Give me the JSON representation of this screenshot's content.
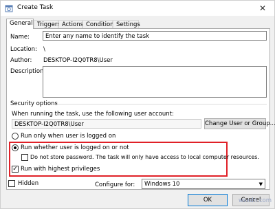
{
  "window": {
    "title": "Create Task",
    "close_glyph": "✕"
  },
  "tabs": [
    {
      "label": "General"
    },
    {
      "label": "Triggers"
    },
    {
      "label": "Actions"
    },
    {
      "label": "Conditions"
    },
    {
      "label": "Settings"
    }
  ],
  "general": {
    "name_label": "Name:",
    "name_value": "Enter any name to identify the task",
    "location_label": "Location:",
    "location_value": "\\",
    "author_label": "Author:",
    "author_value": "DESKTOP-I2Q0TR8\\User",
    "description_label": "Description:"
  },
  "security": {
    "group_label": "Security options",
    "account_prompt": "When running the task, use the following user account:",
    "account_value": "DESKTOP-I2Q0TR8\\User",
    "change_button": "Change User or Group...",
    "radio_logged_on": "Run only when user is logged on",
    "radio_whether": "Run whether user is logged on or not",
    "radio_selected": "whether",
    "check_no_password": "Do not store password.  The task will only have access to local computer resources.",
    "check_highest": "Run with highest privileges",
    "check_highest_checked": true
  },
  "bottom": {
    "hidden_label": "Hidden",
    "configure_label": "Configure for:",
    "configure_value": "Windows 10"
  },
  "buttons": {
    "ok": "OK",
    "cancel": "Cancel"
  },
  "watermark": "wsxdn.com",
  "colors": {
    "highlight": "#e02027",
    "window_bg": "#f0f0f0"
  }
}
